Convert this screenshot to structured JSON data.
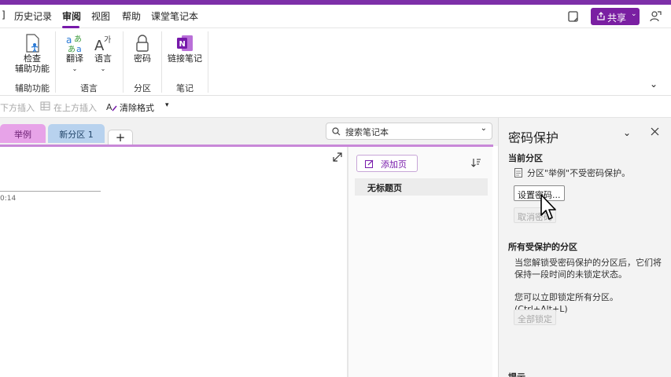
{
  "menu": {
    "items": [
      "历史记录",
      "审阅",
      "视图",
      "帮助",
      "课堂笔记本"
    ],
    "active": "审阅",
    "share_label": "共享"
  },
  "ribbon": {
    "check_accessibility": [
      "检查",
      "辅助功能"
    ],
    "translate": "翻译",
    "language": "语言",
    "password": "密码",
    "link_notes": "链接笔记",
    "groups": [
      "辅助功能",
      "语言",
      "分区",
      "笔记"
    ]
  },
  "quick": {
    "insert_below": "下方插入",
    "insert_above": "在上方插入",
    "clear_format": "清除格式"
  },
  "tabs": {
    "active": "举例",
    "other": "新分区 1",
    "add": "+"
  },
  "search": {
    "placeholder": "搜索笔记本"
  },
  "page": {
    "time": "0:14"
  },
  "pages_panel": {
    "add_page": "添加页",
    "items": [
      "无标题页"
    ]
  },
  "password_pane": {
    "title": "密码保护",
    "current_section_heading": "当前分区",
    "section_status": "分区\"举例\"不受密码保护。",
    "set_password": "设置密码...",
    "remove_password": "取消密码",
    "all_protected_heading": "所有受保护的分区",
    "unlock_info_line1": "当您解锁受密码保护的分区后，它们将",
    "unlock_info_line2": "保持一段时间的未锁定状态。",
    "lock_info": "您可以立即锁定所有分区。(Ctrl+Alt+L)",
    "lock_all": "全部锁定",
    "tips_heading": "提示"
  },
  "colors": {
    "accent": "#7719aa",
    "share_bg": "#7a1fa2",
    "tab_active": "#e7a3e8",
    "tab_other": "#b8d2ee"
  }
}
